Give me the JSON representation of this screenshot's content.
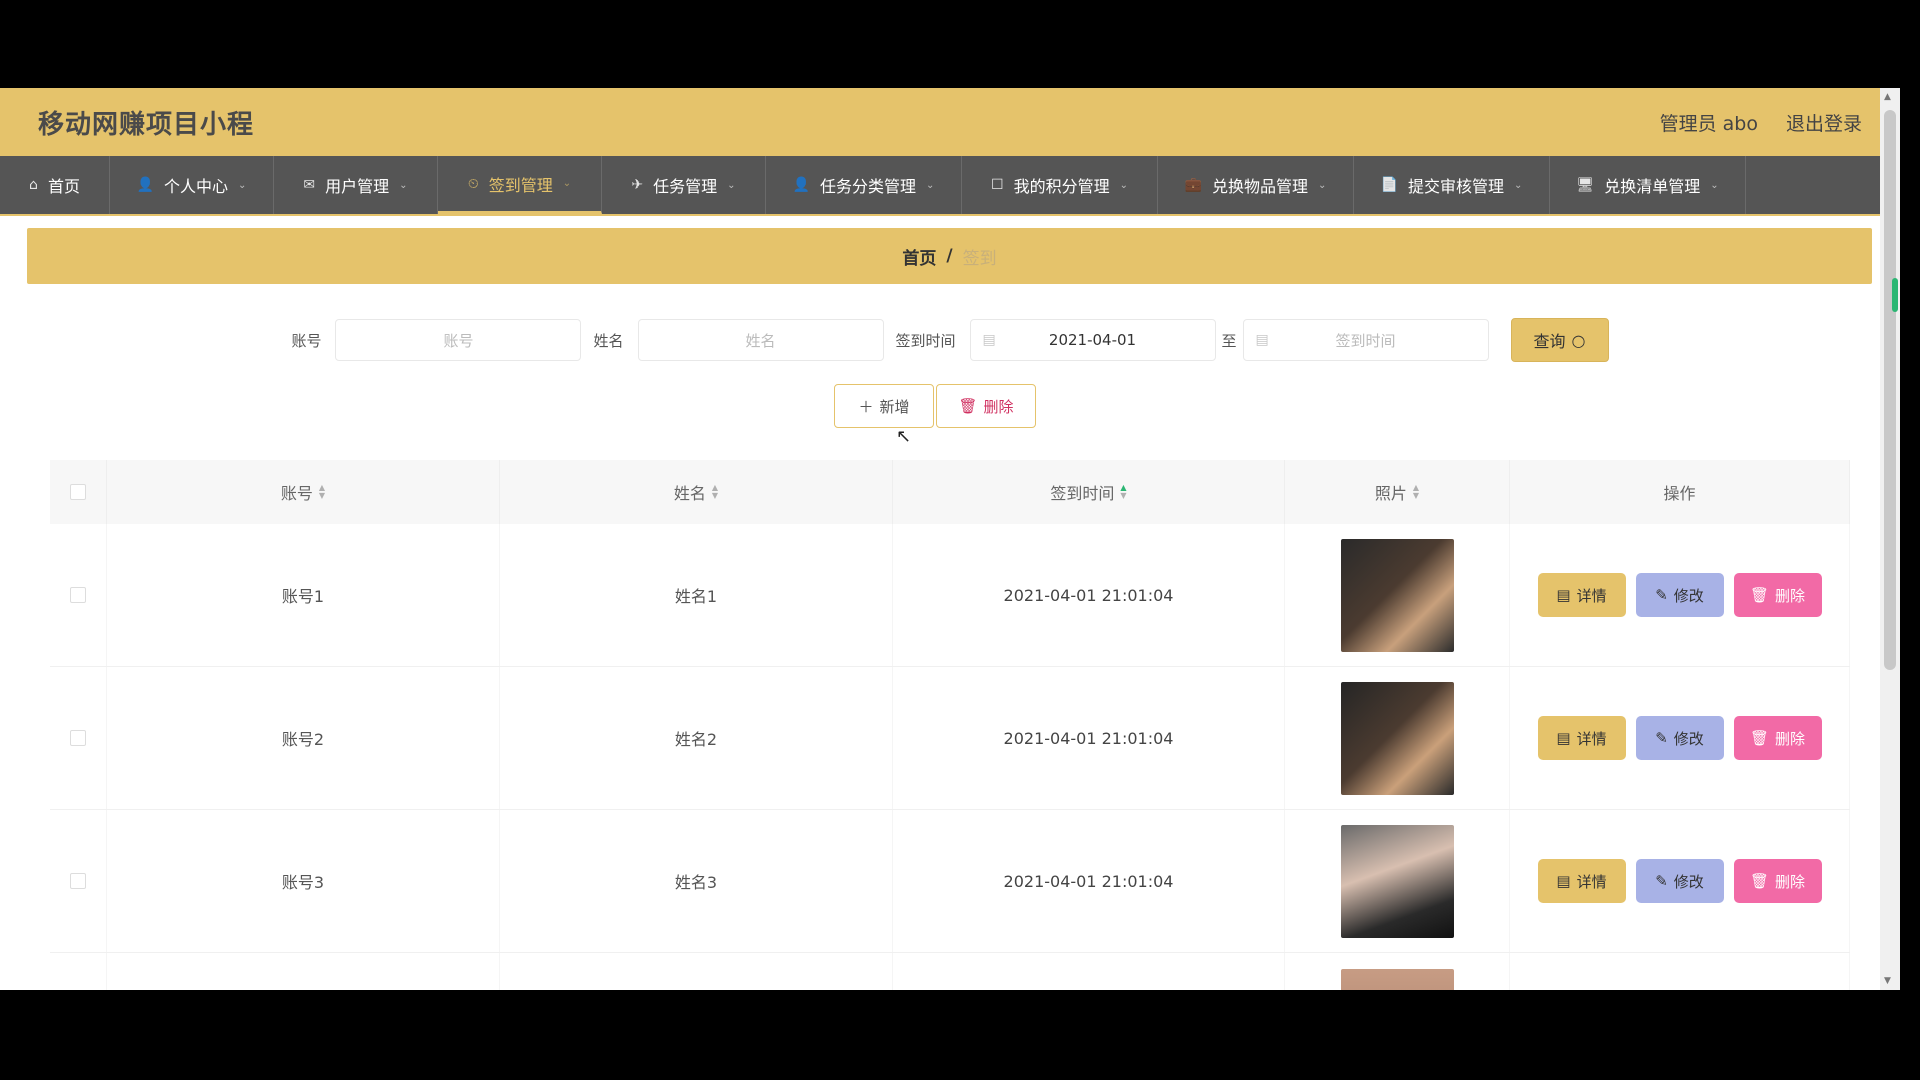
{
  "header": {
    "title": "移动网赚项目小程",
    "admin": "管理员 abo",
    "logout": "退出登录"
  },
  "nav": [
    {
      "label": "首页",
      "icon": "home-icon",
      "glyph": "⌂",
      "chev": false
    },
    {
      "label": "个人中心",
      "icon": "user-icon",
      "glyph": "👤",
      "chev": true
    },
    {
      "label": "用户管理",
      "icon": "mail-icon",
      "glyph": "✉",
      "chev": true
    },
    {
      "label": "签到管理",
      "icon": "clock-icon",
      "glyph": "⏲",
      "chev": true,
      "active": true
    },
    {
      "label": "任务管理",
      "icon": "send-icon",
      "glyph": "✈",
      "chev": true
    },
    {
      "label": "任务分类管理",
      "icon": "person-icon",
      "glyph": "👤",
      "chev": true
    },
    {
      "label": "我的积分管理",
      "icon": "clipboard-icon",
      "glyph": "☐",
      "chev": true
    },
    {
      "label": "兑换物品管理",
      "icon": "briefcase-icon",
      "glyph": "💼",
      "chev": true
    },
    {
      "label": "提交审核管理",
      "icon": "document-icon",
      "glyph": "📄",
      "chev": true
    },
    {
      "label": "兑换清单管理",
      "icon": "monitor-icon",
      "glyph": "🖥",
      "chev": true
    }
  ],
  "breadcrumb": {
    "home": "首页",
    "sep": "/",
    "current": "签到"
  },
  "search": {
    "account_label": "账号",
    "account_placeholder": "账号",
    "name_label": "姓名",
    "name_placeholder": "姓名",
    "time_label": "签到时间",
    "start_value": "2021-04-01",
    "to_label": "至",
    "end_placeholder": "签到时间",
    "query_label": "查询"
  },
  "actions": {
    "add_label": "新增",
    "delete_label": "删除"
  },
  "table": {
    "columns": [
      "账号",
      "姓名",
      "签到时间",
      "照片",
      "操作"
    ],
    "sorted_column": "签到时间",
    "rows": [
      {
        "account": "账号1",
        "name": "姓名1",
        "time": "2021-04-01 21:01:04"
      },
      {
        "account": "账号2",
        "name": "姓名2",
        "time": "2021-04-01 21:01:04"
      },
      {
        "account": "账号3",
        "name": "姓名3",
        "time": "2021-04-01 21:01:04"
      }
    ],
    "row_actions": {
      "detail": "详情",
      "edit": "修改",
      "delete": "删除"
    }
  },
  "colors": {
    "accent": "#e5c36b",
    "nav_bg": "#555555",
    "edit": "#a8b2e6",
    "delete": "#f26aa6"
  }
}
